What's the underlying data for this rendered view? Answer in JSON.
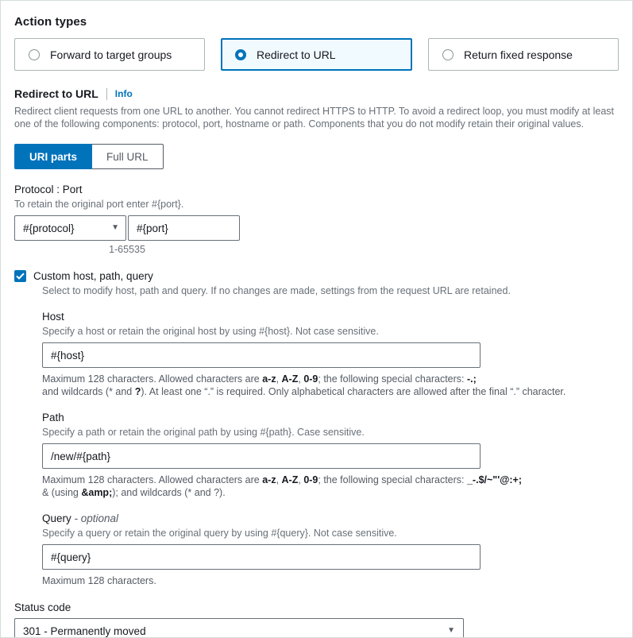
{
  "action_types": {
    "title": "Action types",
    "options": [
      {
        "label": "Forward to target groups",
        "selected": false
      },
      {
        "label": "Redirect to URL",
        "selected": true
      },
      {
        "label": "Return fixed response",
        "selected": false
      }
    ]
  },
  "redirect": {
    "title": "Redirect to URL",
    "info_label": "Info",
    "description": "Redirect client requests from one URL to another. You cannot redirect HTTPS to HTTP. To avoid a redirect loop, you must modify at least one of the following components: protocol, port, hostname or path. Components that you do not modify retain their original values.",
    "tabs": [
      {
        "label": "URI parts",
        "active": true
      },
      {
        "label": "Full URL",
        "active": false
      }
    ]
  },
  "protocol_port": {
    "label": "Protocol : Port",
    "hint": "To retain the original port enter #{port}.",
    "protocol_value": "#{protocol}",
    "port_value": "#{port}",
    "port_range": "1-65535"
  },
  "custom": {
    "checkbox_label": "Custom host, path, query",
    "checkbox_checked": true,
    "checkbox_hint": "Select to modify host, path and query. If no changes are made, settings from the request URL are retained.",
    "host": {
      "label": "Host",
      "hint": "Specify a host or retain the original host by using #{host}. Not case sensitive.",
      "value": "#{host}",
      "constraint_line1_a": "Maximum 128 characters. Allowed characters are ",
      "constraint_line1_b": "a-z",
      "constraint_line1_c": ", ",
      "constraint_line1_d": "A-Z",
      "constraint_line1_e": ", ",
      "constraint_line1_f": "0-9",
      "constraint_line1_g": "; the following special characters: ",
      "constraint_line1_h": "-.;",
      "constraint_line2_a": "and wildcards (* and ",
      "constraint_line2_b": "?",
      "constraint_line2_c": "). At least one “.” is required. Only alphabetical characters are allowed after the final “.” character."
    },
    "path": {
      "label": "Path",
      "hint": "Specify a path or retain the original path by using #{path}. Case sensitive.",
      "value": "/new/#{path}",
      "constraint_line1_a": "Maximum 128 characters. Allowed characters are ",
      "constraint_line1_b": "a-z",
      "constraint_line1_c": ", ",
      "constraint_line1_d": "A-Z",
      "constraint_line1_e": ", ",
      "constraint_line1_f": "0-9",
      "constraint_line1_g": "; the following special characters: ",
      "constraint_line1_h": "_-.$/~\"'@:+;",
      "constraint_line2_a": "& (using ",
      "constraint_line2_b": "&amp;",
      "constraint_line2_c": "); and wildcards (* and ?)."
    },
    "query": {
      "label": "Query",
      "label_optional": " - optional",
      "hint": "Specify a query or retain the original query by using #{query}. Not case sensitive.",
      "value": "#{query}",
      "constraint": "Maximum 128 characters."
    }
  },
  "status_code": {
    "label": "Status code",
    "value": "301 - Permanently moved"
  },
  "icons": {
    "caret_down": "▼",
    "checkmark": "check-icon"
  },
  "colors": {
    "accent_blue": "#0073bb",
    "selected_bg": "#f1faff",
    "text_dark": "#16191f",
    "text_muted": "#687078",
    "border": "#687078"
  }
}
